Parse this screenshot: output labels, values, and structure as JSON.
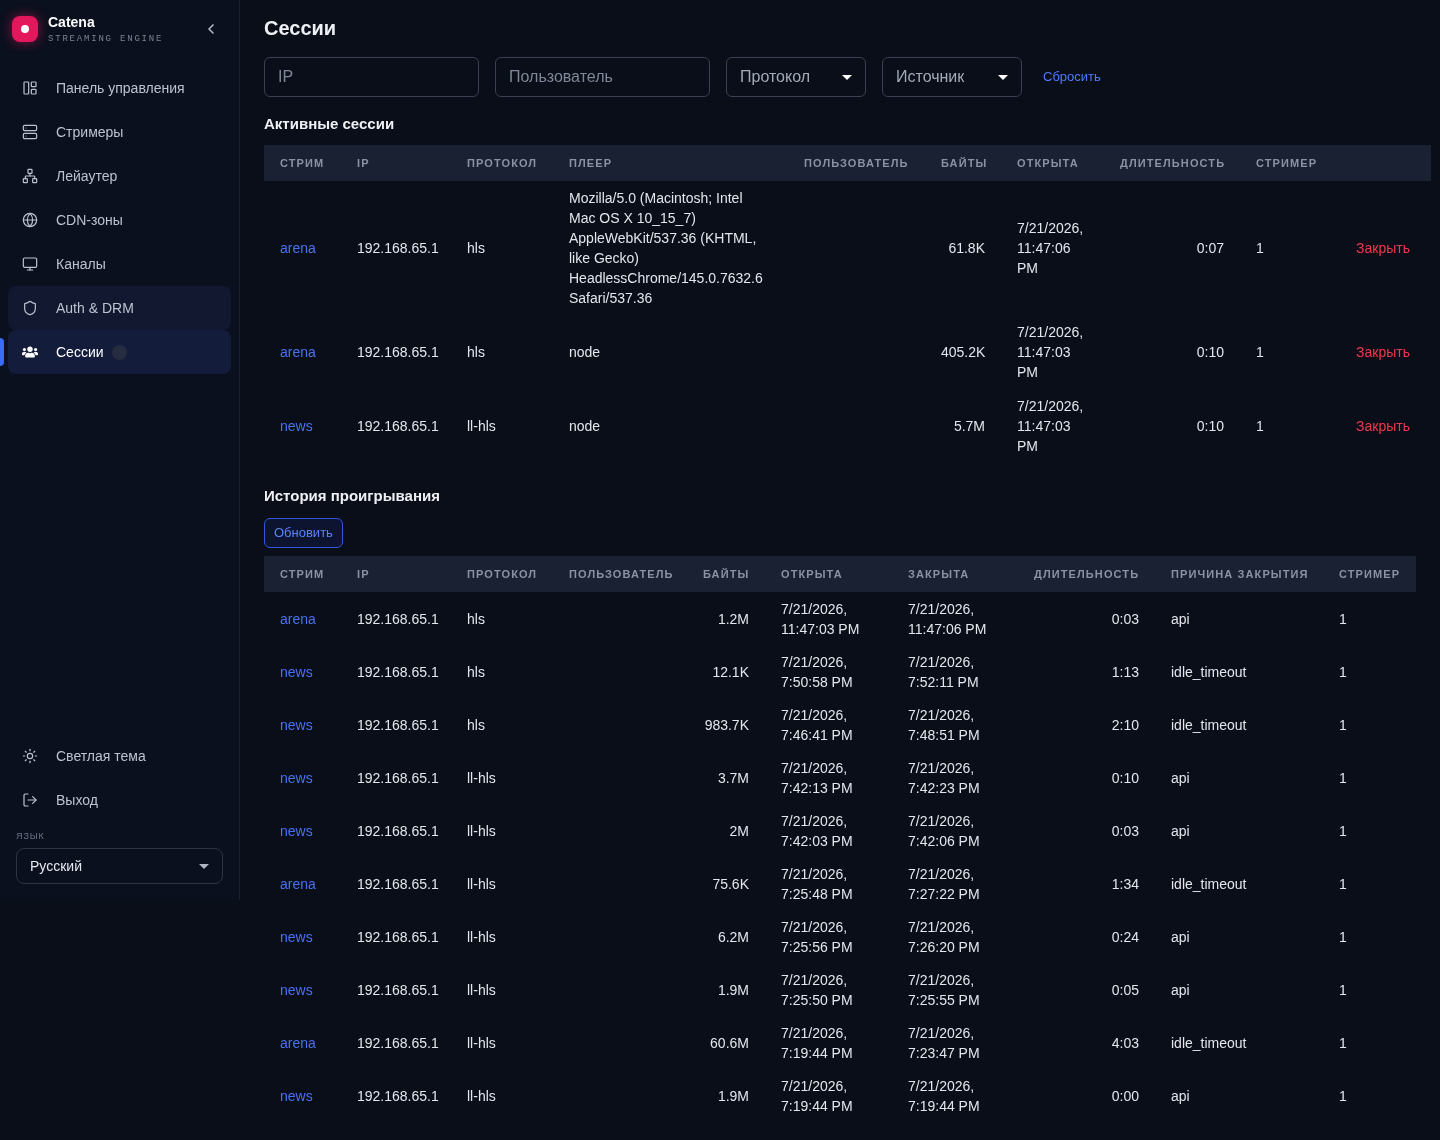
{
  "sidebar": {
    "brand": {
      "name": "Catena",
      "tagline": "STREAMING ENGINE"
    },
    "nav": [
      {
        "label": "Панель управления",
        "selected": false,
        "hovered": false,
        "badge": false
      },
      {
        "label": "Стримеры",
        "selected": false,
        "hovered": false,
        "badge": false
      },
      {
        "label": "Лейаутер",
        "selected": false,
        "hovered": false,
        "badge": false
      },
      {
        "label": "CDN-зоны",
        "selected": false,
        "hovered": false,
        "badge": false
      },
      {
        "label": "Каналы",
        "selected": false,
        "hovered": false,
        "badge": false
      },
      {
        "label": "Auth & DRM",
        "selected": false,
        "hovered": true,
        "badge": false
      },
      {
        "label": "Сессии",
        "selected": true,
        "hovered": false,
        "badge": true
      }
    ],
    "footer_items": [
      "Светлая тема",
      "Выход"
    ],
    "language": {
      "label": "ЯЗЫК",
      "value": "Русский"
    }
  },
  "page": {
    "title": "Сессии"
  },
  "filters": {
    "fields": [
      {
        "kind": "input",
        "placeholder": "IP"
      },
      {
        "kind": "input",
        "placeholder": "Пользователь"
      },
      {
        "kind": "select",
        "value": "Протокол"
      },
      {
        "kind": "select",
        "value": "Источник"
      }
    ],
    "reset": "Сбросить"
  },
  "active_sessions": {
    "title": "Активные сессии",
    "columns": [
      "СТРИМ",
      "IP",
      "ПРОТОКОЛ",
      "ПЛЕЕР",
      "ПОЛЬЗОВАТЕЛЬ",
      "БАЙТЫ",
      "ОТКРЫТА",
      "ДЛИТЕЛЬНОСТЬ",
      "СТРИМЕР"
    ],
    "rows": [
      {
        "stream": "arena",
        "ip": "192.168.65.1",
        "protocol": "hls",
        "player": "Mozilla/5.0 (Macintosh; Intel Mac OS X 10_15_7) AppleWebKit/537.36 (KHTML, like Gecko) HeadlessChrome/145.0.7632.6 Safari/537.36",
        "bytes": "61.8K",
        "opened": "7/21/2026, 11:47:06 PM",
        "duration": "0:07",
        "streamer": "1",
        "action": "Закрыть"
      },
      {
        "stream": "arena",
        "ip": "192.168.65.1",
        "protocol": "hls",
        "player": "node",
        "bytes": "405.2K",
        "opened": "7/21/2026, 11:47:03 PM",
        "duration": "0:10",
        "streamer": "1",
        "action": "Закрыть"
      },
      {
        "stream": "news",
        "ip": "192.168.65.1",
        "protocol": "ll-hls",
        "player": "node",
        "bytes": "5.7M",
        "opened": "7/21/2026, 11:47:03 PM",
        "duration": "0:10",
        "streamer": "1",
        "action": "Закрыть"
      }
    ]
  },
  "history": {
    "title": "История проигрывания",
    "refresh": "Обновить",
    "columns": [
      "СТРИМ",
      "IP",
      "ПРОТОКОЛ",
      "ПОЛЬЗОВАТЕЛЬ",
      "БАЙТЫ",
      "ОТКРЫТА",
      "ЗАКРЫТА",
      "ДЛИТЕЛЬНОСТЬ",
      "ПРИЧИНА ЗАКРЫТИЯ",
      "СТРИМЕР"
    ],
    "rows": [
      {
        "stream": "arena",
        "ip": "192.168.65.1",
        "protocol": "hls",
        "bytes": "1.2M",
        "opened": "7/21/2026, 11:47:03 PM",
        "closed": "7/21/2026, 11:47:06 PM",
        "duration": "0:03",
        "reason": "api",
        "streamer": "1"
      },
      {
        "stream": "news",
        "ip": "192.168.65.1",
        "protocol": "hls",
        "bytes": "12.1K",
        "opened": "7/21/2026, 7:50:58 PM",
        "closed": "7/21/2026, 7:52:11 PM",
        "duration": "1:13",
        "reason": "idle_timeout",
        "streamer": "1"
      },
      {
        "stream": "news",
        "ip": "192.168.65.1",
        "protocol": "hls",
        "bytes": "983.7K",
        "opened": "7/21/2026, 7:46:41 PM",
        "closed": "7/21/2026, 7:48:51 PM",
        "duration": "2:10",
        "reason": "idle_timeout",
        "streamer": "1"
      },
      {
        "stream": "news",
        "ip": "192.168.65.1",
        "protocol": "ll-hls",
        "bytes": "3.7M",
        "opened": "7/21/2026, 7:42:13 PM",
        "closed": "7/21/2026, 7:42:23 PM",
        "duration": "0:10",
        "reason": "api",
        "streamer": "1"
      },
      {
        "stream": "news",
        "ip": "192.168.65.1",
        "protocol": "ll-hls",
        "bytes": "2M",
        "opened": "7/21/2026, 7:42:03 PM",
        "closed": "7/21/2026, 7:42:06 PM",
        "duration": "0:03",
        "reason": "api",
        "streamer": "1"
      },
      {
        "stream": "arena",
        "ip": "192.168.65.1",
        "protocol": "ll-hls",
        "bytes": "75.6K",
        "opened": "7/21/2026, 7:25:48 PM",
        "closed": "7/21/2026, 7:27:22 PM",
        "duration": "1:34",
        "reason": "idle_timeout",
        "streamer": "1"
      },
      {
        "stream": "news",
        "ip": "192.168.65.1",
        "protocol": "ll-hls",
        "bytes": "6.2M",
        "opened": "7/21/2026, 7:25:56 PM",
        "closed": "7/21/2026, 7:26:20 PM",
        "duration": "0:24",
        "reason": "api",
        "streamer": "1"
      },
      {
        "stream": "news",
        "ip": "192.168.65.1",
        "protocol": "ll-hls",
        "bytes": "1.9M",
        "opened": "7/21/2026, 7:25:50 PM",
        "closed": "7/21/2026, 7:25:55 PM",
        "duration": "0:05",
        "reason": "api",
        "streamer": "1"
      },
      {
        "stream": "arena",
        "ip": "192.168.65.1",
        "protocol": "ll-hls",
        "bytes": "60.6M",
        "opened": "7/21/2026, 7:19:44 PM",
        "closed": "7/21/2026, 7:23:47 PM",
        "duration": "4:03",
        "reason": "idle_timeout",
        "streamer": "1"
      },
      {
        "stream": "news",
        "ip": "192.168.65.1",
        "protocol": "ll-hls",
        "bytes": "1.9M",
        "opened": "7/21/2026, 7:19:44 PM",
        "closed": "7/21/2026, 7:19:44 PM",
        "duration": "0:00",
        "reason": "api",
        "streamer": "1"
      }
    ]
  }
}
